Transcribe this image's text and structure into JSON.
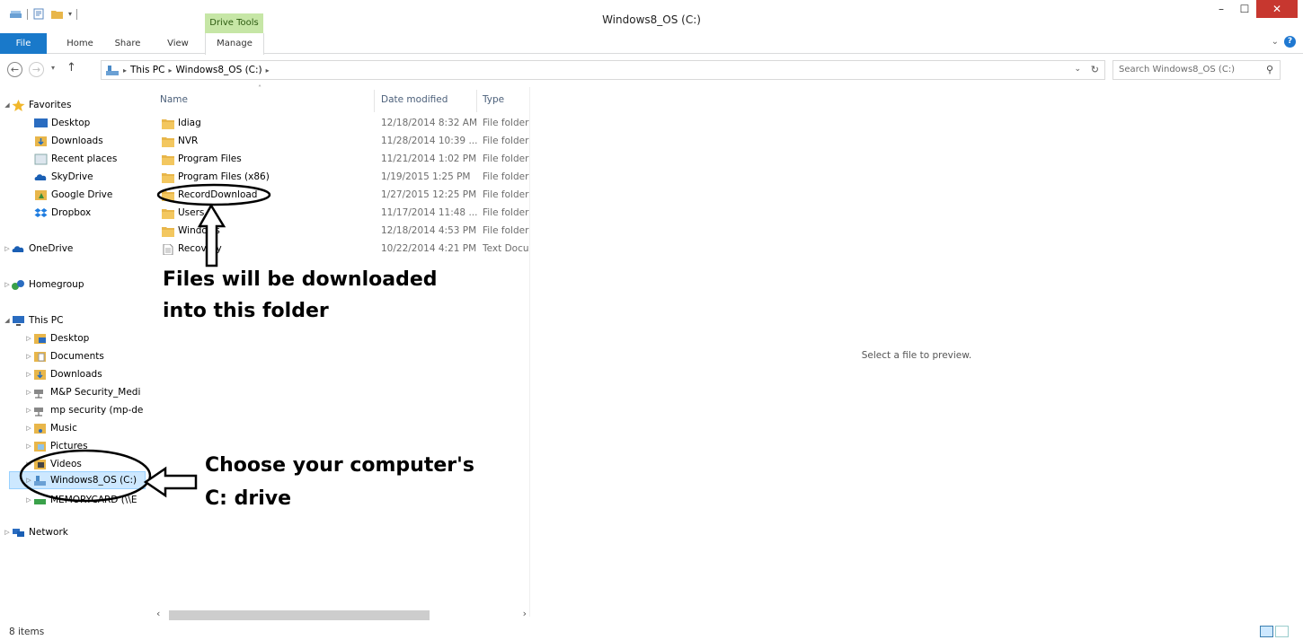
{
  "window": {
    "title": "Windows8_OS (C:)",
    "context_tab": "Drive Tools",
    "minimize": "–",
    "maximize": "☐",
    "close": "✕"
  },
  "ribbon": {
    "tabs": [
      "File",
      "Home",
      "Share",
      "View",
      "Manage"
    ],
    "help": "?"
  },
  "address": {
    "segments": [
      "This PC",
      "Windows8_OS (C:)"
    ],
    "search_placeholder": "Search Windows8_OS (C:)"
  },
  "nav": {
    "favorites": "Favorites",
    "fav_items": [
      "Desktop",
      "Downloads",
      "Recent places",
      "SkyDrive",
      "Google Drive",
      "Dropbox"
    ],
    "onedrive": "OneDrive",
    "homegroup": "Homegroup",
    "thispc": "This PC",
    "pc_items": [
      "Desktop",
      "Documents",
      "Downloads",
      "M&P Security_Medi",
      "mp security (mp-de",
      "Music",
      "Pictures",
      "Videos",
      "Windows8_OS (C:)",
      "MEMORYCARD (\\\\E"
    ],
    "network": "Network"
  },
  "files": {
    "columns": [
      "Name",
      "Date modified",
      "Type"
    ],
    "rows": [
      {
        "name": "Idiag",
        "date": "12/18/2014 8:32 AM",
        "type": "File folder",
        "kind": "folder"
      },
      {
        "name": "NVR",
        "date": "11/28/2014 10:39 ...",
        "type": "File folder",
        "kind": "folder"
      },
      {
        "name": "Program Files",
        "date": "11/21/2014 1:02 PM",
        "type": "File folder",
        "kind": "folder"
      },
      {
        "name": "Program Files (x86)",
        "date": "1/19/2015 1:25 PM",
        "type": "File folder",
        "kind": "folder"
      },
      {
        "name": "RecordDownload",
        "date": "1/27/2015 12:25 PM",
        "type": "File folder",
        "kind": "folder"
      },
      {
        "name": "Users",
        "date": "11/17/2014 11:48 ...",
        "type": "File folder",
        "kind": "folder"
      },
      {
        "name": "Windows",
        "date": "12/18/2014 4:53 PM",
        "type": "File folder",
        "kind": "folder"
      },
      {
        "name": "Recovery",
        "date": "10/22/2014 4:21 PM",
        "type": "Text Docu",
        "kind": "text"
      }
    ]
  },
  "preview": {
    "text": "Select a file to preview."
  },
  "status": {
    "count": "8 items"
  },
  "annotations": {
    "folder_note_1": "Files will be downloaded",
    "folder_note_2": "into this folder",
    "drive_note_1": "Choose your computer's",
    "drive_note_2": "C: drive"
  },
  "colors": {
    "file_tab": "#1979ca",
    "drive_tools": "#c6e6a6",
    "close_button": "#c7372f",
    "selection": "#cde8ff",
    "folder": "#e8b64a"
  }
}
